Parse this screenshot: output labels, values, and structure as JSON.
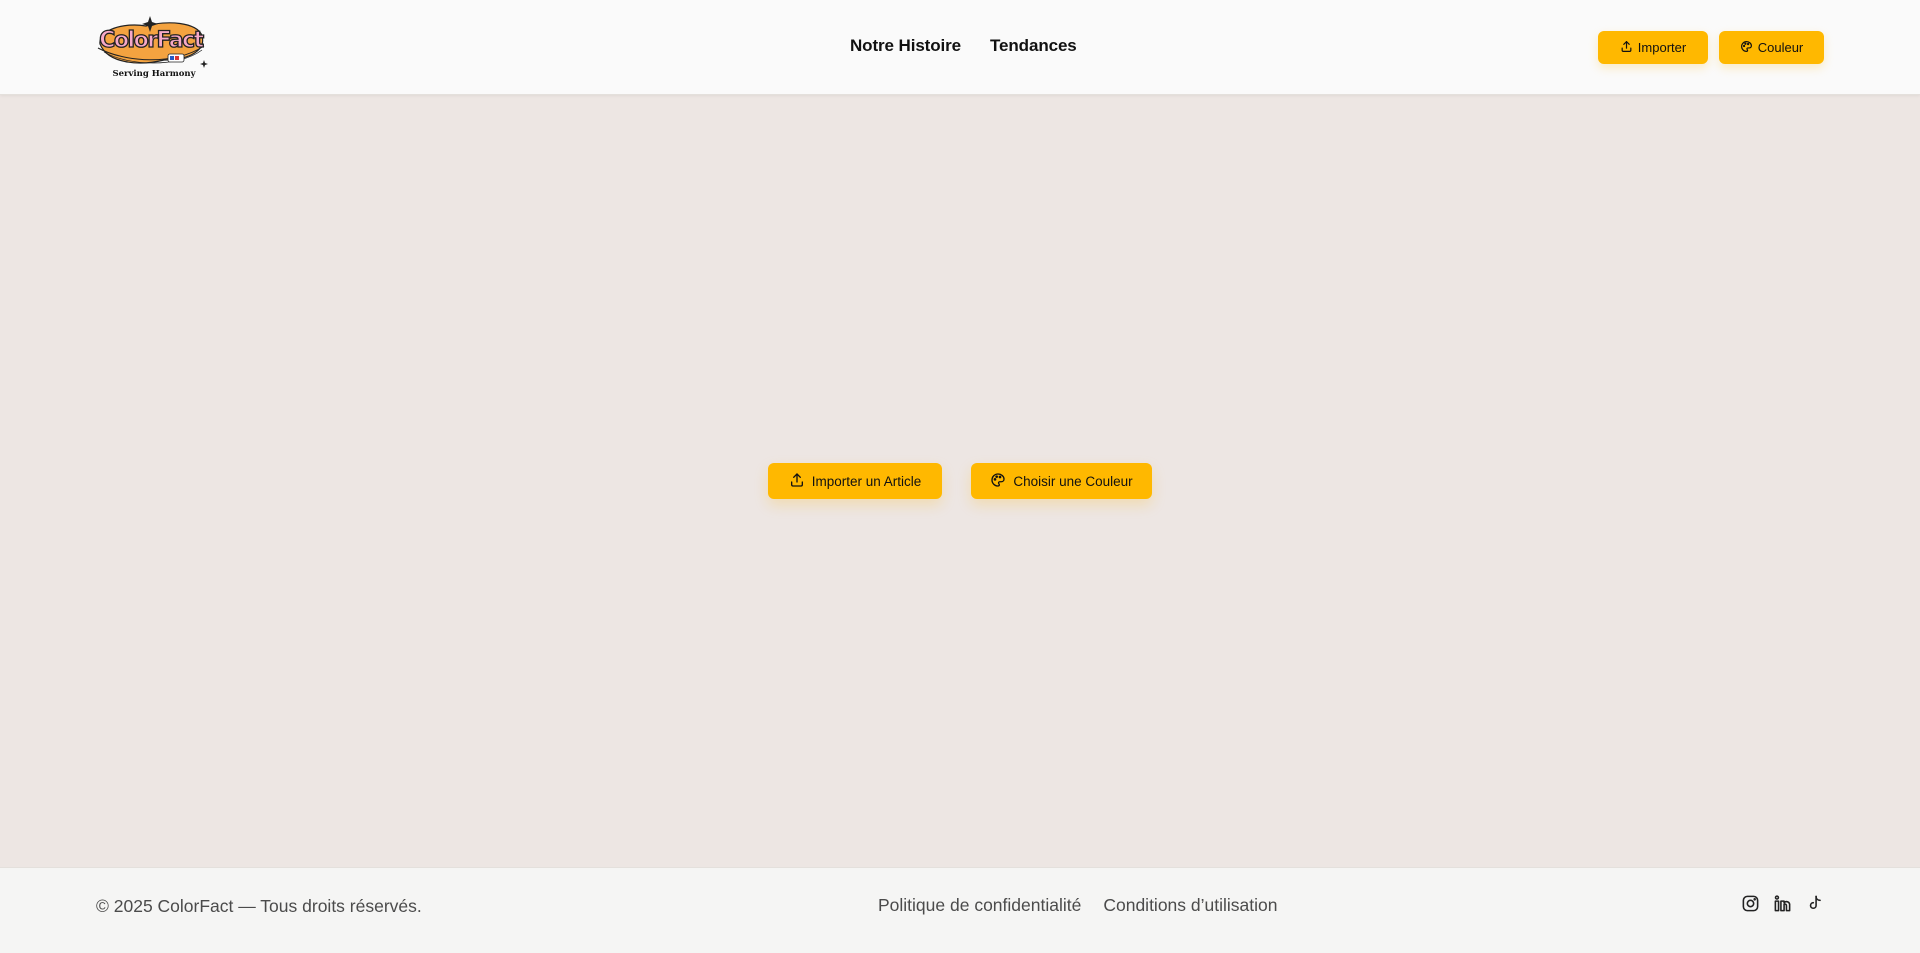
{
  "header": {
    "logo": {
      "brand": "ColorFact",
      "tagline": "Serving Harmony"
    },
    "nav": [
      {
        "label": "Notre Histoire"
      },
      {
        "label": "Tendances"
      }
    ],
    "buttons": {
      "import_label": "Importer",
      "import_icon": "upload-icon",
      "color_label": "Couleur",
      "color_icon": "palette-icon"
    }
  },
  "main": {
    "import_label": "Importer un Article",
    "import_icon": "upload-icon",
    "color_label": "Choisir une Couleur",
    "color_icon": "palette-icon"
  },
  "footer": {
    "copyright": "© 2025 ColorFact — Tous droits réservés.",
    "links": [
      {
        "label": "Politique de confidentialité"
      },
      {
        "label": "Conditions d’utilisation"
      }
    ],
    "social": [
      "instagram-icon",
      "linkedin-icon",
      "tiktok-icon"
    ]
  },
  "colors": {
    "accent": "#ffb800",
    "page_background": "#ede6e3",
    "header_background": "#fafafa",
    "footer_background": "#f5f5f4",
    "footer_text": "#4b4b4b"
  }
}
